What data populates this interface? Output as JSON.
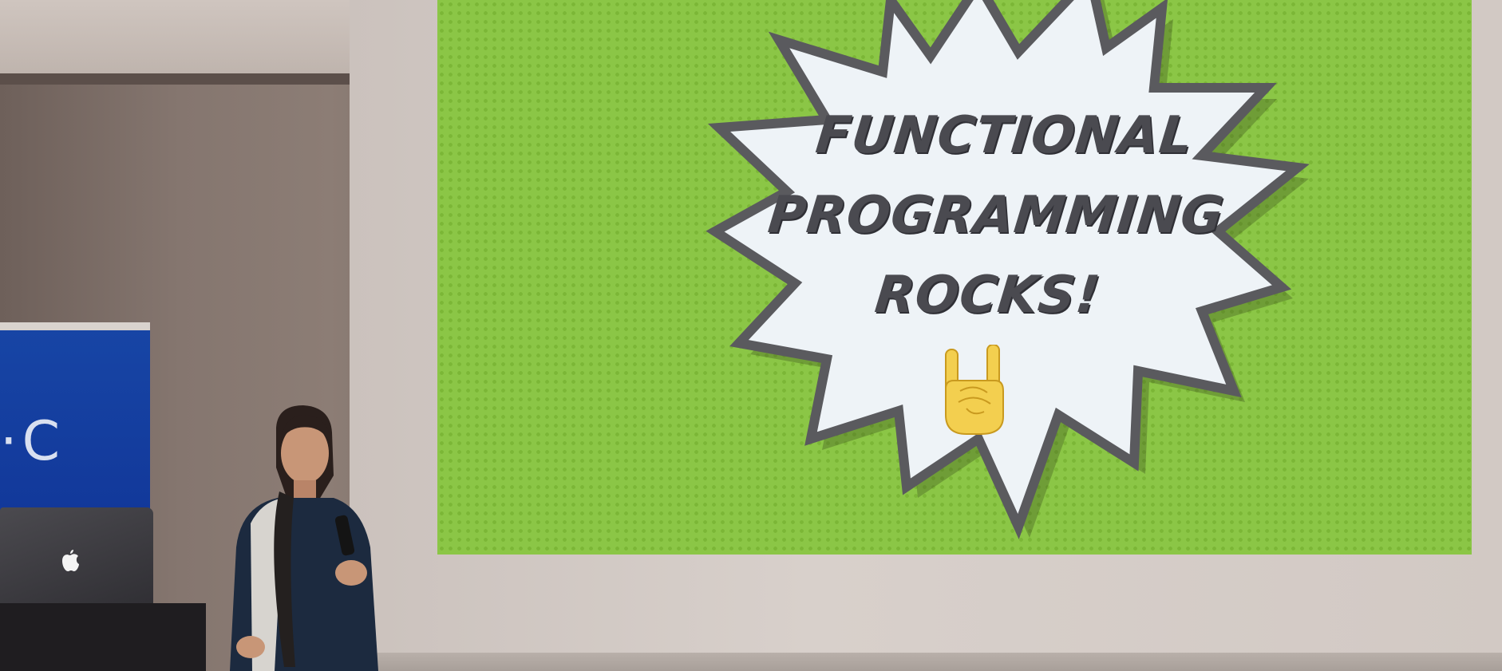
{
  "slide": {
    "title_lines": [
      "FUNCTIONAL",
      "PROGRAMMING",
      "ROCKS!"
    ],
    "background_color": "#8bc646",
    "burst_fill": "#eef3f7",
    "burst_outline": "#5a5a5e",
    "text_color": "#4a4a50",
    "emoji": "sign-of-the-horns-hand-icon"
  },
  "banner": {
    "text": "·C",
    "color": "#1745a5"
  },
  "laptop": {
    "logo": "apple-logo-icon"
  }
}
